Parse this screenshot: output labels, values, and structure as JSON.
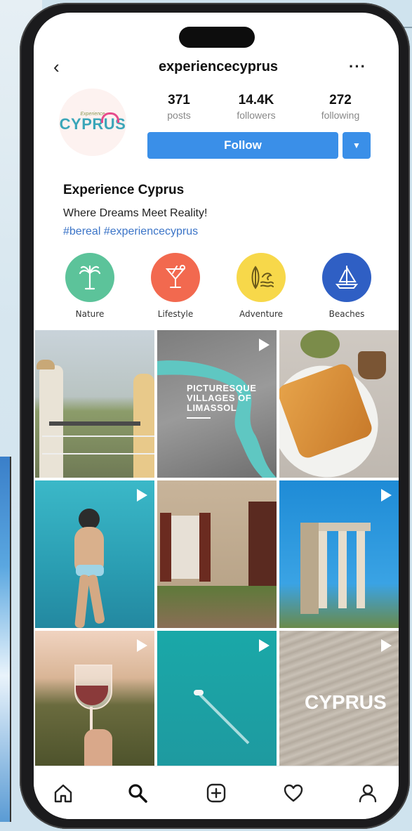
{
  "header": {
    "username": "experiencecyprus",
    "back_icon": "chevron-left-icon",
    "more_icon": "more-horizontal-icon"
  },
  "profile": {
    "avatar_subtext": "Experience",
    "avatar_brand": "CYPRUS",
    "stats": [
      {
        "value": "371",
        "label": "posts"
      },
      {
        "value": "14.4K",
        "label": "followers"
      },
      {
        "value": "272",
        "label": "following"
      }
    ],
    "follow_label": "Follow",
    "display_name": "Experience Cyprus",
    "bio": "Where Dreams Meet Reality!",
    "hashtags": "#bereal #experiencecyprus"
  },
  "highlights": [
    {
      "label": "Nature",
      "color": "#5cc39a",
      "icon": "palm-tree-icon"
    },
    {
      "label": "Lifestyle",
      "color": "#f2694f",
      "icon": "cocktail-glass-icon"
    },
    {
      "label": "Adventure",
      "color": "#f7d84a",
      "icon": "surfboard-wave-icon"
    },
    {
      "label": "Beaches",
      "color": "#2f5fc4",
      "icon": "sailboat-icon"
    }
  ],
  "posts": [
    {
      "label": "couple-toasting-wine",
      "video": false
    },
    {
      "label": "villages-of-limassol",
      "video": true,
      "overlay": "PICTURESQUE VILLAGES OF LIMASSOL"
    },
    {
      "label": "pastry-dish",
      "video": false
    },
    {
      "label": "swimmer-underwater",
      "video": true
    },
    {
      "label": "stone-village-house",
      "video": false
    },
    {
      "label": "ancient-temple-columns",
      "video": true
    },
    {
      "label": "wine-glass-sunset",
      "video": true
    },
    {
      "label": "boat-turquoise-sea",
      "video": true
    },
    {
      "label": "sand-ripples-logo",
      "video": true,
      "overlay": "CYPRUS"
    }
  ],
  "nav": [
    {
      "name": "home-icon"
    },
    {
      "name": "search-icon"
    },
    {
      "name": "add-post-icon"
    },
    {
      "name": "heart-icon"
    },
    {
      "name": "profile-icon"
    }
  ],
  "colors": {
    "accent": "#3a8fe8",
    "hashtag": "#3b74c7"
  }
}
